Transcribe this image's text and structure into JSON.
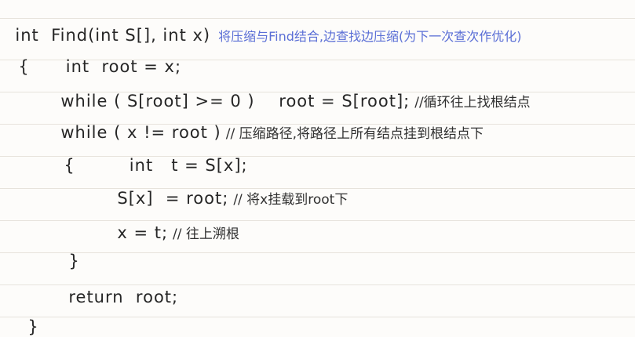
{
  "lines": [
    {
      "code": "int  Find(int S[], int x)",
      "note": "将压缩与Find结合,边查找边压缩(为下一次查次作优化)"
    },
    {
      "code": "{      int  root = x;",
      "note": ""
    },
    {
      "code": "while ( S[root] >= 0 )    root = S[root];",
      "note": "//循环往上找根结点"
    },
    {
      "code": "while ( x != root )",
      "note": "// 压缩路径,将路径上所有结点挂到根结点下"
    },
    {
      "code": "{         int   t = S[x];",
      "note": ""
    },
    {
      "code": "S[x]  = root;",
      "note": "// 将x挂载到root下"
    },
    {
      "code": "x = t;",
      "note": "// 往上溯根"
    },
    {
      "code": "}",
      "note": ""
    },
    {
      "code": "return  root;",
      "note": ""
    },
    {
      "code": "}",
      "note": ""
    }
  ]
}
